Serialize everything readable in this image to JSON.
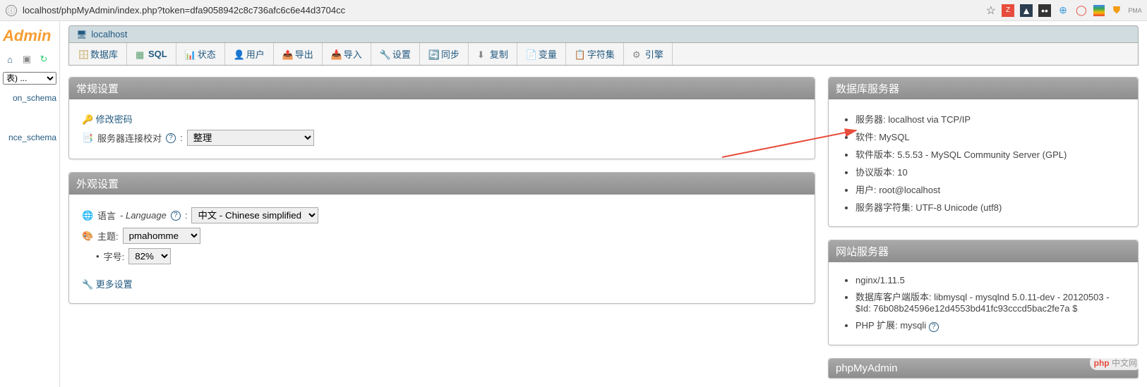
{
  "browser": {
    "url": "localhost/phpMyAdmin/index.php?token=dfa9058942c8c736afc6c6e44d3704cc",
    "star": "☆"
  },
  "logo": "Admin",
  "sidebar": {
    "select_label": "表) ...",
    "items": [
      "on_schema",
      "nce_schema"
    ]
  },
  "server_breadcrumb": "localhost",
  "tabs": [
    {
      "label": "数据库"
    },
    {
      "label": "SQL"
    },
    {
      "label": "状态"
    },
    {
      "label": "用户"
    },
    {
      "label": "导出"
    },
    {
      "label": "导入"
    },
    {
      "label": "设置"
    },
    {
      "label": "同步"
    },
    {
      "label": "复制"
    },
    {
      "label": "变量"
    },
    {
      "label": "字符集"
    },
    {
      "label": "引擎"
    }
  ],
  "general": {
    "title": "常规设置",
    "change_pw": "修改密码",
    "collation_label": "服务器连接校对",
    "collation_value": "整理"
  },
  "appearance": {
    "title": "外观设置",
    "lang_label": "语言",
    "lang_label2": "Language",
    "lang_value": "中文 - Chinese simplified",
    "theme_label": "主题:",
    "theme_value": "pmahomme",
    "font_label": "字号:",
    "font_value": "82%",
    "more_settings": "更多设置"
  },
  "db_server": {
    "title": "数据库服务器",
    "items": [
      "服务器: localhost via TCP/IP",
      "软件: MySQL",
      "软件版本: 5.5.53 - MySQL Community Server (GPL)",
      "协议版本: 10",
      "用户: root@localhost",
      "服务器字符集: UTF-8 Unicode (utf8)"
    ]
  },
  "web_server": {
    "title": "网站服务器",
    "items": [
      "nginx/1.11.5",
      "数据库客户端版本: libmysql - mysqlnd 5.0.11-dev - 20120503 - $Id: 76b08b24596e12d4553bd41fc93cccd5bac2fe7a $",
      "PHP 扩展: mysqli"
    ]
  },
  "pma_panel": {
    "title": "phpMyAdmin"
  },
  "watermark": {
    "p1": "php",
    "p2": "中文网"
  }
}
